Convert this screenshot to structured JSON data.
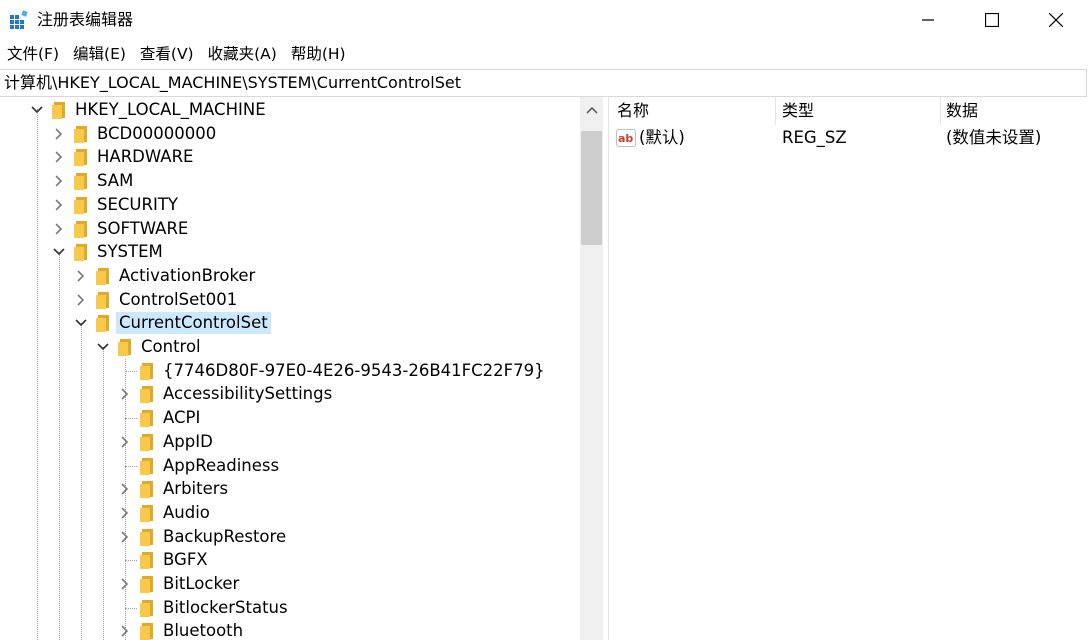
{
  "window": {
    "title": "注册表编辑器"
  },
  "menu": [
    {
      "label": "文件(F)"
    },
    {
      "label": "编辑(E)"
    },
    {
      "label": "查看(V)"
    },
    {
      "label": "收藏夹(A)"
    },
    {
      "label": "帮助(H)"
    }
  ],
  "address": {
    "path": "计算机\\HKEY_LOCAL_MACHINE\\SYSTEM\\CurrentControlSet"
  },
  "tree": {
    "nodes": [
      {
        "label": "HKEY_LOCAL_MACHINE",
        "expander": "expanded"
      },
      {
        "label": "BCD00000000",
        "expander": "collapsed"
      },
      {
        "label": "HARDWARE",
        "expander": "collapsed"
      },
      {
        "label": "SAM",
        "expander": "collapsed"
      },
      {
        "label": "SECURITY",
        "expander": "collapsed"
      },
      {
        "label": "SOFTWARE",
        "expander": "collapsed"
      },
      {
        "label": "SYSTEM",
        "expander": "expanded"
      },
      {
        "label": "ActivationBroker",
        "expander": "collapsed"
      },
      {
        "label": "ControlSet001",
        "expander": "collapsed"
      },
      {
        "label": "CurrentControlSet",
        "expander": "expanded",
        "selected": true
      },
      {
        "label": "Control",
        "expander": "expanded"
      },
      {
        "label": "{7746D80F-97E0-4E26-9543-26B41FC22F79}",
        "expander": "none"
      },
      {
        "label": "AccessibilitySettings",
        "expander": "collapsed"
      },
      {
        "label": "ACPI",
        "expander": "none"
      },
      {
        "label": "AppID",
        "expander": "collapsed"
      },
      {
        "label": "AppReadiness",
        "expander": "none"
      },
      {
        "label": "Arbiters",
        "expander": "collapsed"
      },
      {
        "label": "Audio",
        "expander": "collapsed"
      },
      {
        "label": "BackupRestore",
        "expander": "collapsed"
      },
      {
        "label": "BGFX",
        "expander": "none"
      },
      {
        "label": "BitLocker",
        "expander": "collapsed"
      },
      {
        "label": "BitlockerStatus",
        "expander": "none"
      },
      {
        "label": "Bluetooth",
        "expander": "collapsed"
      }
    ]
  },
  "values": {
    "columns": [
      "名称",
      "类型",
      "数据"
    ],
    "rows": [
      {
        "name": "(默认)",
        "type": "REG_SZ",
        "data": "(数值未设置)",
        "icon": "string-value-icon"
      }
    ]
  },
  "colors": {
    "selection": "#cce8ff",
    "folder": "#f8c94a",
    "scrollbar_track": "#f0f0f0",
    "scrollbar_thumb": "#cdcdcd"
  }
}
